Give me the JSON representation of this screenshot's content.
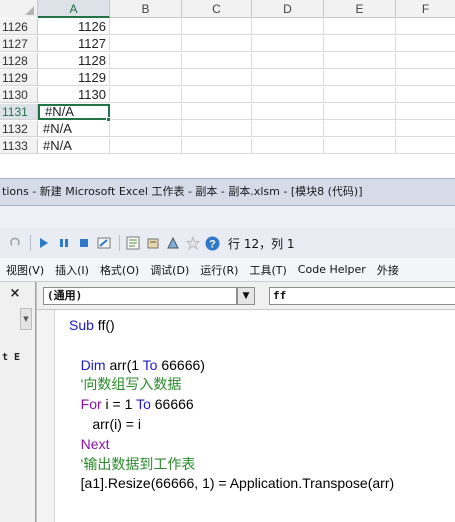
{
  "sheet": {
    "columns": [
      "A",
      "B",
      "C",
      "D",
      "E",
      "F"
    ],
    "rows": [
      {
        "num": "1126",
        "a": "1126"
      },
      {
        "num": "1127",
        "a": "1127"
      },
      {
        "num": "1128",
        "a": "1128"
      },
      {
        "num": "1129",
        "a": "1129"
      },
      {
        "num": "1130",
        "a": "1130"
      },
      {
        "num": "1131",
        "a": "#N/A"
      },
      {
        "num": "1132",
        "a": "#N/A"
      },
      {
        "num": "1133",
        "a": "#N/A"
      }
    ]
  },
  "vbe": {
    "title": "tions - 新建 Microsoft Excel 工作表 - 副本 - 副本.xlsm - [模块8 (代码)]",
    "cursor_position": "行 12，列 1",
    "menu": [
      "视图(V)",
      "插入(I)",
      "格式(O)",
      "调试(D)",
      "运行(R)",
      "工具(T)",
      "Code Helper",
      "外接"
    ],
    "left_panel": {
      "close": "×",
      "label": "t E"
    },
    "object_combo": "(通用)",
    "procedure_combo": "ff",
    "code": {
      "line1_kw": "Sub",
      "line1_rest": " ff()",
      "line2_kw": "Dim",
      "line2_a": " arr(1 ",
      "line2_kw2": "To",
      "line2_b": " 66666)",
      "line3": "'向数组写入数据",
      "line4_kw": "For",
      "line4_a": " i = 1 ",
      "line4_kw2": "To",
      "line4_b": " 66666",
      "line5": "   arr(i) = i",
      "line6": "Next",
      "line7": "'输出数据到工作表",
      "line8": "[a1].Resize(66666, 1) = Application.Transpose(arr)"
    }
  },
  "colors": {
    "keyword": "#1a1acc",
    "purple_keyword": "#8b12a8",
    "comment": "#2a8a2a",
    "excel_green": "#217346"
  }
}
